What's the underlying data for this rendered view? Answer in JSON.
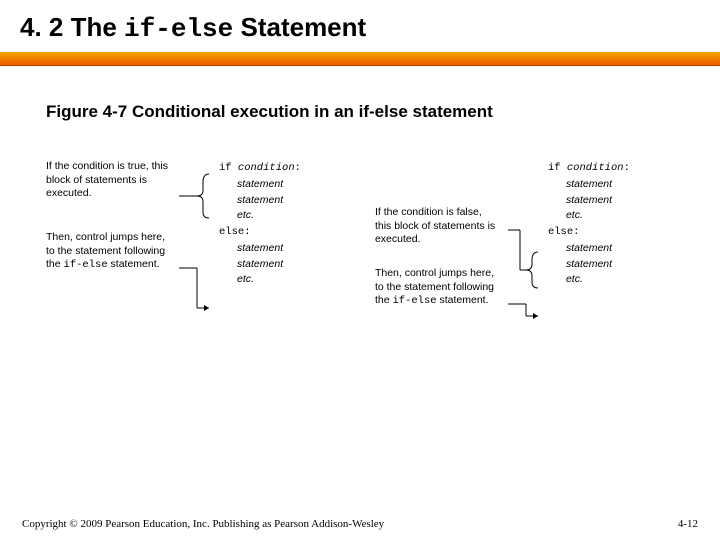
{
  "title_prefix": "4. 2 The ",
  "title_code": "if-else",
  "title_suffix": " Statement",
  "figure_caption": "Figure 4-7  Conditional execution in an if-else statement",
  "left": {
    "label1": "If the condition is true, this block of statements is executed.",
    "label2_a": "Then, control jumps here, to the statement following the ",
    "label2_code": "if-else",
    "label2_b": " statement."
  },
  "right": {
    "label1": "If the condition is false, this block of statements is executed.",
    "label2_a": "Then, control jumps here, to the statement following the ",
    "label2_code": "if-else",
    "label2_b": " statement."
  },
  "code": {
    "if_line_kw": "if ",
    "if_line_cond": "condition",
    "if_line_colon": ":",
    "stmt": "statement",
    "etc": "etc.",
    "else_kw": "else",
    "else_colon": ":"
  },
  "footer": {
    "copyright": "Copyright © 2009 Pearson Education, Inc. Publishing as Pearson Addison-Wesley",
    "page": "4-12"
  }
}
